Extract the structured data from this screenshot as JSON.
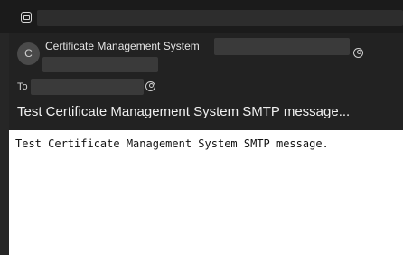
{
  "window": {
    "title_redacted": true,
    "icon": "mail-window-icon"
  },
  "message": {
    "from_avatar_initial": "C",
    "from_name": "Certificate Management System",
    "to_label": "To",
    "subject": "Test Certificate Management System SMTP message...",
    "body": "Test Certificate Management System SMTP message."
  },
  "icons": {
    "from_contact": "contact-card-icon",
    "to_contact": "contact-card-icon"
  },
  "colors": {
    "background": "#1f1f1f",
    "header": "#222222",
    "body_bg": "#ffffff",
    "text_light": "#e4e4e4"
  }
}
